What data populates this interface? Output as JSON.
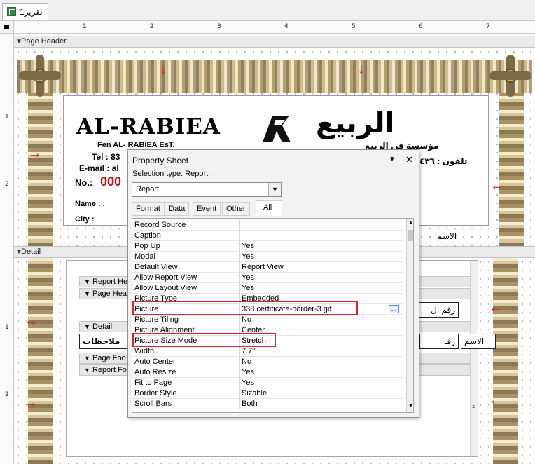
{
  "tab": {
    "title": "تقرير1",
    "icon": "report-icon"
  },
  "ruler": {
    "h": [
      "1",
      "2",
      "3",
      "4",
      "5",
      "6",
      "7"
    ],
    "v": [
      "1",
      "2",
      "1",
      "2"
    ]
  },
  "sections": {
    "page_header": "Page Header",
    "detail": "Detail"
  },
  "logo": {
    "latin": "AL-RABIEA",
    "arabic": "الربيع",
    "subline_en": "Fen AL- RABIEA EsT.",
    "subline_ar": "مؤسسة فن الربيع",
    "tel": "Tel : 83",
    "email": "E-mail : al",
    "phone_ar": "تلفون : ٤٣٦",
    "no_label": "No.:",
    "no_value": "000",
    "name_label": "Name : .",
    "city_label": "City : ",
    "ism_label": "الاسم"
  },
  "subform": {
    "bars": [
      "Report He",
      "Page Hea",
      "Detail",
      "Page Foo",
      "Report Fo"
    ],
    "field_right_top": "رقم ال",
    "field_right_mid": "رقـ",
    "field_ism": "الاسم",
    "notes": "ملاحظات"
  },
  "property_sheet": {
    "title": "Property Sheet",
    "selection_type": "Selection type:  Report",
    "combo_value": "Report",
    "tabs": [
      "Format",
      "Data",
      "Event",
      "Other",
      "All"
    ],
    "active_tab": "All",
    "rows": [
      {
        "name": "Record Source",
        "value": ""
      },
      {
        "name": "Caption",
        "value": ""
      },
      {
        "name": "Pop Up",
        "value": "Yes"
      },
      {
        "name": "Modal",
        "value": "Yes"
      },
      {
        "name": "Default View",
        "value": "Report View"
      },
      {
        "name": "Allow Report View",
        "value": "Yes"
      },
      {
        "name": "Allow Layout View",
        "value": "Yes"
      },
      {
        "name": "Picture Type",
        "value": "Embedded"
      },
      {
        "name": "Picture",
        "value": "338.certificate-border-3.gif"
      },
      {
        "name": "Picture Tiling",
        "value": "No"
      },
      {
        "name": "Picture Alignment",
        "value": "Center"
      },
      {
        "name": "Picture Size Mode",
        "value": "Stretch"
      },
      {
        "name": "Width",
        "value": "7.7\""
      },
      {
        "name": "Auto Center",
        "value": "No"
      },
      {
        "name": "Auto Resize",
        "value": "Yes"
      },
      {
        "name": "Fit to Page",
        "value": "Yes"
      },
      {
        "name": "Border Style",
        "value": "Sizable"
      },
      {
        "name": "Scroll Bars",
        "value": "Both"
      }
    ],
    "build_button": "...",
    "dropdown_glyph": "▼",
    "close_glyph": "✕"
  },
  "colors": {
    "highlight": "#d9232a",
    "arrow": "#e02424",
    "logo_number": "#c0141b"
  }
}
